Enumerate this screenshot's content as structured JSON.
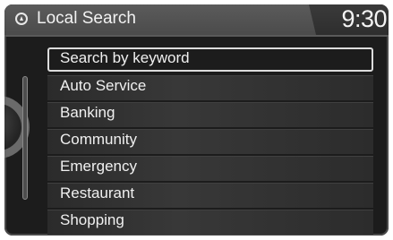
{
  "header": {
    "title": "Local Search",
    "clock": "9:30",
    "icon": "navigation-icon"
  },
  "menu": {
    "items": [
      {
        "label": "Search by keyword",
        "selected": true
      },
      {
        "label": "Auto Service"
      },
      {
        "label": "Banking"
      },
      {
        "label": "Community"
      },
      {
        "label": "Emergency"
      },
      {
        "label": "Restaurant"
      },
      {
        "label": "Shopping"
      }
    ]
  },
  "colors": {
    "background": "#1c1c1c",
    "header": "#555555",
    "text": "#f0f0f0",
    "selection_border": "#dcdcdc"
  }
}
